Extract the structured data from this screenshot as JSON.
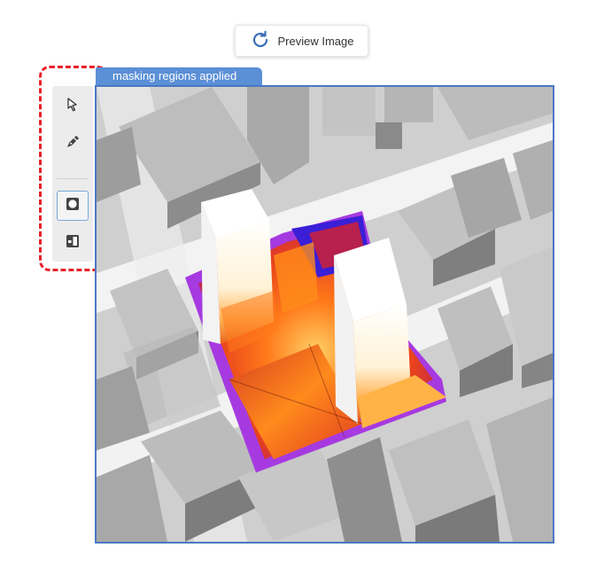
{
  "preview_button": {
    "label": "Preview Image",
    "icon": "refresh-icon"
  },
  "toolbar": {
    "tools": [
      {
        "name": "select-tool",
        "icon": "pointer-arrow-icon",
        "active": false
      },
      {
        "name": "pen-tool",
        "icon": "pen-icon",
        "active": false
      },
      {
        "name": "mask-region-tool",
        "icon": "mask-square-icon",
        "active": true
      },
      {
        "name": "compare-tool",
        "icon": "split-view-icon",
        "active": false
      }
    ]
  },
  "image_panel": {
    "label": "masking regions applied"
  },
  "colors": {
    "accent": "#5b8fd6",
    "highlight": "#e8202a",
    "frame": "#4a78c2"
  }
}
